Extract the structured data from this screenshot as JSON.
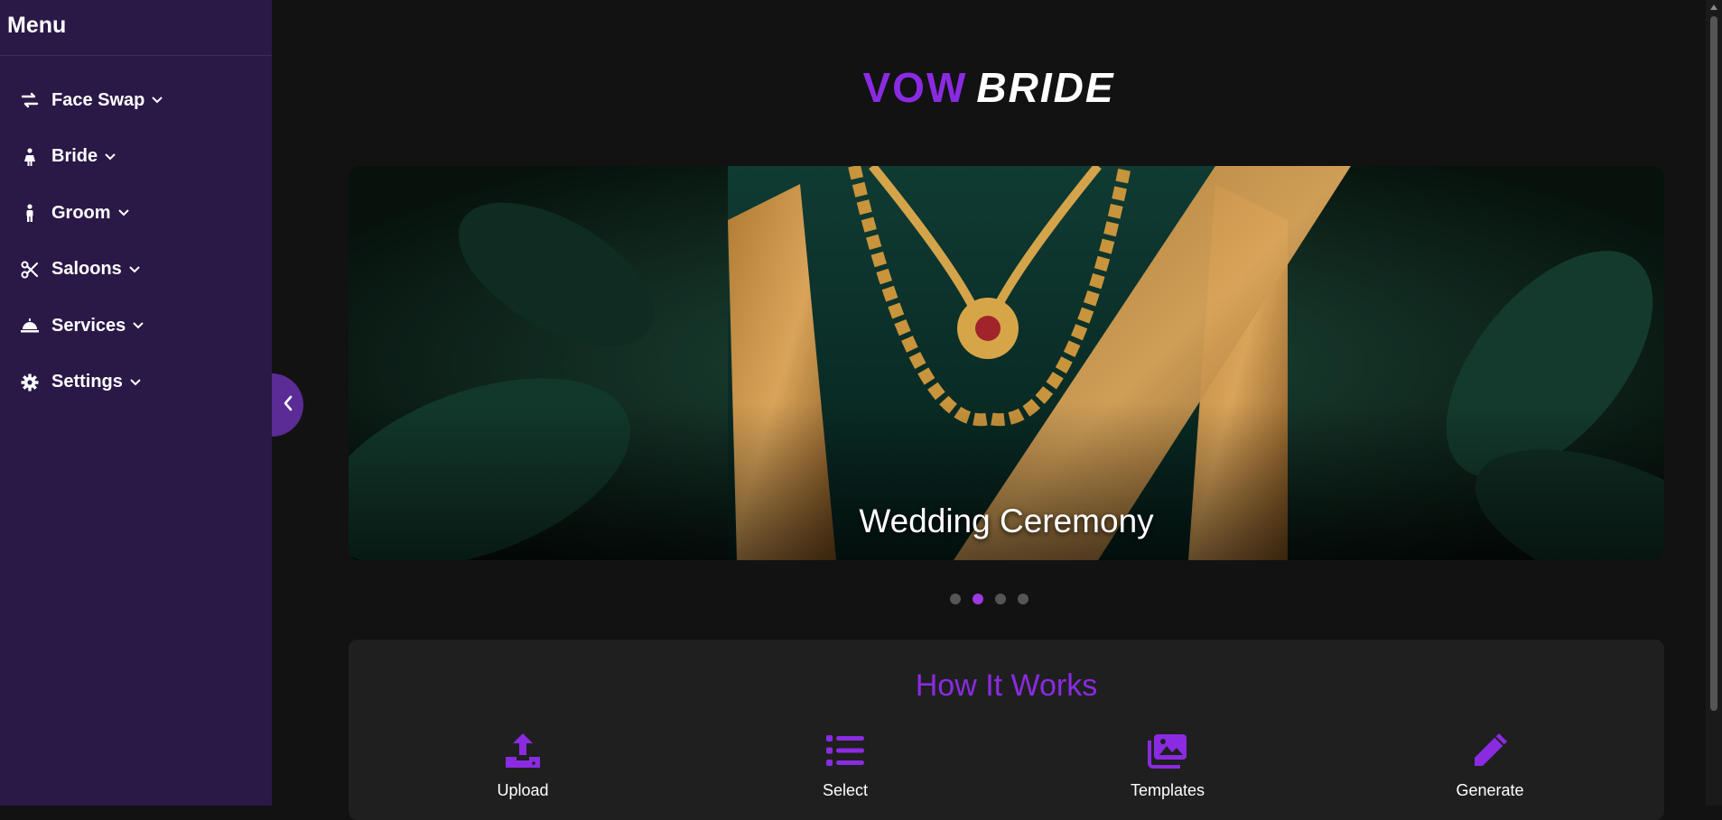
{
  "sidebar": {
    "title": "Menu",
    "items": [
      {
        "label": "Face Swap",
        "icon": "swap-arrows-icon"
      },
      {
        "label": "Bride",
        "icon": "bride-icon"
      },
      {
        "label": "Groom",
        "icon": "groom-icon"
      },
      {
        "label": "Saloons",
        "icon": "scissors-icon"
      },
      {
        "label": "Services",
        "icon": "service-bell-icon"
      },
      {
        "label": "Settings",
        "icon": "gear-icon"
      }
    ]
  },
  "brand": {
    "part1": "VOW",
    "part2": "BRIDE"
  },
  "hero": {
    "caption": "Wedding Ceremony",
    "active_slide": 2,
    "slide_count": 4
  },
  "how_it_works": {
    "title": "How It Works",
    "steps": [
      {
        "label": "Upload",
        "icon": "upload-icon"
      },
      {
        "label": "Select",
        "icon": "list-icon"
      },
      {
        "label": "Templates",
        "icon": "images-icon"
      },
      {
        "label": "Generate",
        "icon": "pen-icon"
      }
    ]
  },
  "colors": {
    "accent": "#8a2be2",
    "sidebar_bg": "#2a1847",
    "page_bg": "#121212"
  }
}
